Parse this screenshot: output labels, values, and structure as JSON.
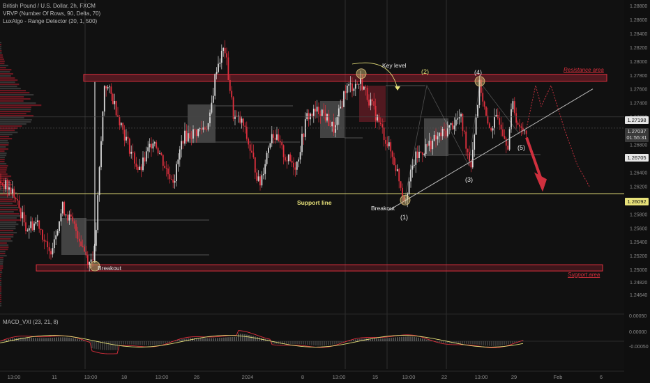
{
  "legend": {
    "line1": "British Pound / U.S. Dollar, 2h, FXCM",
    "line2": "VRVP (Number Of Rows, 90, Delta, 70)",
    "line3": "LuxAlgo - Range Detector (20, 1, 500)"
  },
  "macd_label": "MACD_VXI (23, 21, 8)",
  "annotations": {
    "key_level": "Key level",
    "resistance": "Resistance area",
    "support": "Support area",
    "support_line": "Support line",
    "breakout_left": "Breakout",
    "breakout_right": "Breakout",
    "wave1": "(1)",
    "wave2": "(2)",
    "wave3": "(3)",
    "wave4": "(4)",
    "wave5": "(5)"
  },
  "price_tags": {
    "tag1": "1.27198",
    "tag2_price": "1.27037",
    "tag2_time": "01:55:31",
    "tag3": "1.26705",
    "tag4": "1.26092"
  },
  "colors": {
    "background": "#0f0f0f",
    "candle_up": "#d9d9d9",
    "candle_down": "#e0303e",
    "resistance": "#e0303e",
    "support_line": "#e8e27a",
    "circle": "#d9c27a"
  },
  "chart_data": {
    "type": "candlestick",
    "symbol": "GBP/USD",
    "timeframe": "2h",
    "y_axis": {
      "range": [
        1.244,
        1.2885
      ],
      "ticks": [
        "1.28800",
        "1.28600",
        "1.28400",
        "1.28200",
        "1.28000",
        "1.27800",
        "1.27600",
        "1.27400",
        "1.27200",
        "1.27000",
        "1.26800",
        "1.26600",
        "1.26400",
        "1.26200",
        "1.26000",
        "1.25800",
        "1.25600",
        "1.25400",
        "1.25200",
        "1.25000",
        "1.24820",
        "1.24640"
      ]
    },
    "x_axis": {
      "ticks": [
        "13:00",
        "11",
        "13:00",
        "18",
        "13:00",
        "26",
        "2024",
        "8",
        "13:00",
        "15",
        "13:00",
        "22",
        "13:00",
        "29",
        "Feb",
        "6"
      ]
    },
    "levels": {
      "resistance_area": [
        1.2771,
        1.2781
      ],
      "support_area": [
        1.2498,
        1.2507
      ],
      "support_line": 1.26092
    },
    "price_path": [
      [
        0,
        1.2627
      ],
      [
        18,
        1.2612
      ],
      [
        38,
        1.256
      ],
      [
        55,
        1.257
      ],
      [
        70,
        1.252
      ],
      [
        90,
        1.259
      ],
      [
        110,
        1.2555
      ],
      [
        128,
        1.251
      ],
      [
        136,
        1.2528
      ],
      [
        150,
        1.277
      ],
      [
        162,
        1.2745
      ],
      [
        180,
        1.269
      ],
      [
        200,
        1.264
      ],
      [
        220,
        1.269
      ],
      [
        240,
        1.264
      ],
      [
        250,
        1.263
      ],
      [
        262,
        1.269
      ],
      [
        285,
        1.27
      ],
      [
        300,
        1.271
      ],
      [
        310,
        1.279
      ],
      [
        322,
        1.282
      ],
      [
        335,
        1.272
      ],
      [
        348,
        1.271
      ],
      [
        365,
        1.265
      ],
      [
        372,
        1.262
      ],
      [
        390,
        1.27
      ],
      [
        410,
        1.266
      ],
      [
        425,
        1.265
      ],
      [
        440,
        1.272
      ],
      [
        460,
        1.273
      ],
      [
        480,
        1.27
      ],
      [
        495,
        1.276
      ],
      [
        518,
        1.277
      ],
      [
        540,
        1.272
      ],
      [
        560,
        1.267
      ],
      [
        570,
        1.264
      ],
      [
        580,
        1.26
      ],
      [
        595,
        1.266
      ],
      [
        615,
        1.268
      ],
      [
        640,
        1.27
      ],
      [
        660,
        1.272
      ],
      [
        675,
        1.265
      ],
      [
        688,
        1.277
      ],
      [
        700,
        1.27
      ],
      [
        715,
        1.272
      ],
      [
        728,
        1.268
      ],
      [
        735,
        1.274
      ],
      [
        745,
        1.27
      ],
      [
        755,
        1.2704
      ]
    ],
    "projection": [
      [
        755,
        1.2704
      ],
      [
        768,
        1.2765
      ],
      [
        776,
        1.2735
      ],
      [
        790,
        1.2765
      ],
      [
        810,
        1.27
      ],
      [
        828,
        1.265
      ],
      [
        846,
        1.2618
      ]
    ],
    "macd": {
      "range": [
        -0.0005,
        0.0005
      ],
      "ticks": [
        "0.00050",
        "0.00000",
        "-0.00050"
      ]
    }
  }
}
